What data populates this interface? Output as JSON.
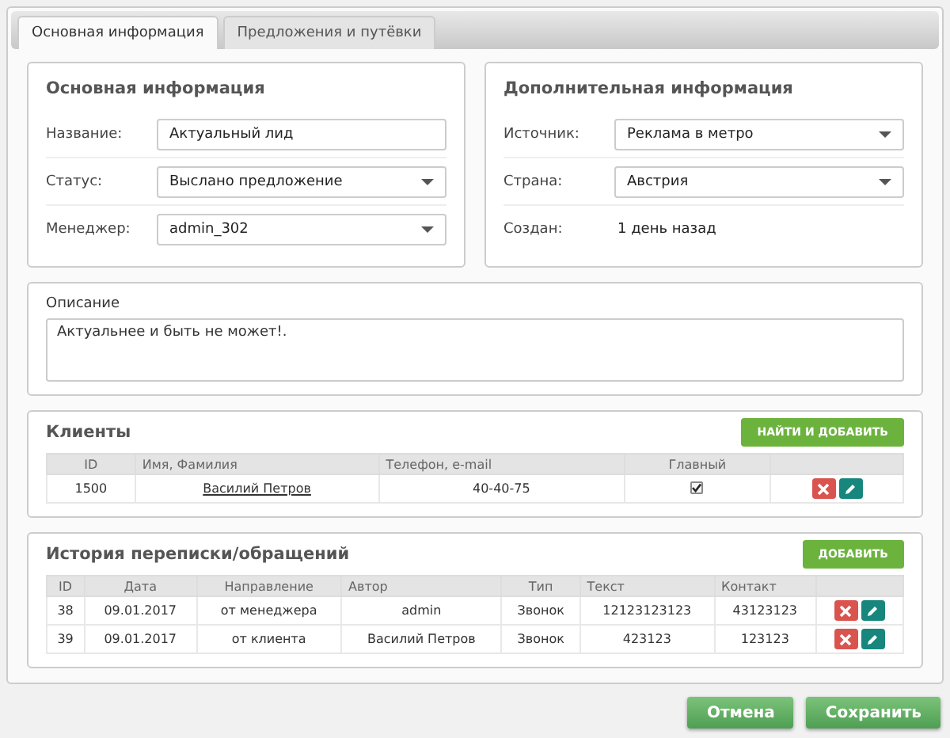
{
  "tabs": [
    {
      "label": "Основная информация",
      "selected": true
    },
    {
      "label": "Предложения и путёвки",
      "selected": false
    }
  ],
  "main_info": {
    "title": "Основная информация",
    "fields": [
      {
        "kind": "input",
        "label": "Название:",
        "value": "Актуальный лид"
      },
      {
        "kind": "select",
        "label": "Статус:",
        "value": "Выслано предложение"
      },
      {
        "kind": "select",
        "label": "Менеджер:",
        "value": "admin_302"
      }
    ]
  },
  "extra_info": {
    "title": "Дополнительная информация",
    "fields": [
      {
        "kind": "select",
        "label": "Источник:",
        "value": "Реклама в метро"
      },
      {
        "kind": "select",
        "label": "Страна:",
        "value": "Австрия"
      },
      {
        "kind": "text",
        "label": "Создан:",
        "value": "1 день назад"
      }
    ]
  },
  "description": {
    "label": "Описание",
    "value": "Актуальнее и быть не может!."
  },
  "clients": {
    "title": "Клиенты",
    "button": "НАЙТИ И ДОБАВИТЬ",
    "columns": [
      "ID",
      "Имя, Фамилия",
      "Телефон, e-mail",
      "Главный"
    ],
    "rows": [
      {
        "id": "1500",
        "name": "Василий Петров",
        "phone": "40-40-75",
        "main": true
      }
    ]
  },
  "history": {
    "title": "История переписки/обращений",
    "button": "ДОБАВИТЬ",
    "columns": [
      "ID",
      "Дата",
      "Направление",
      "Автор",
      "Тип",
      "Текст",
      "Контакт"
    ],
    "rows": [
      {
        "cells": [
          "38",
          "09.01.2017",
          "от менеджера",
          "admin",
          "Звонок",
          "12123123123",
          "43123123"
        ]
      },
      {
        "cells": [
          "39",
          "09.01.2017",
          "от клиента",
          "Василий Петров",
          "Звонок",
          "423123",
          "123123"
        ]
      }
    ]
  },
  "footer": {
    "cancel": "Отмена",
    "save": "Сохранить"
  }
}
